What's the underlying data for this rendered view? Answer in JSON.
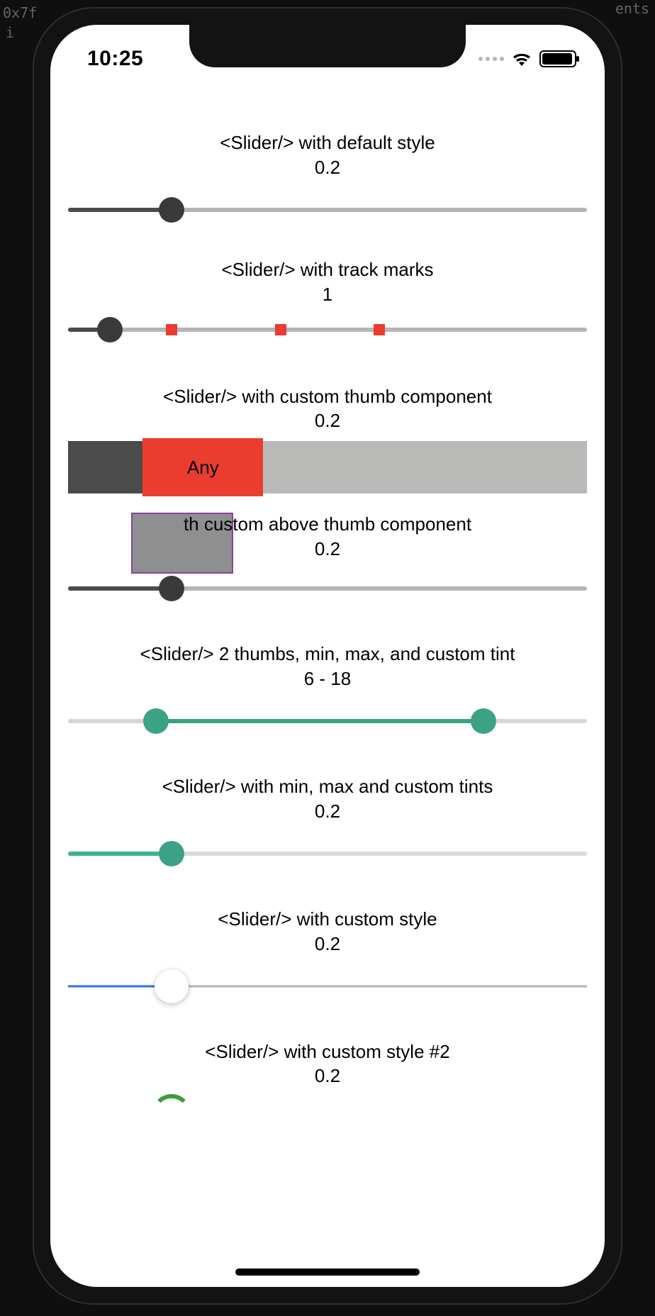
{
  "status_bar": {
    "time": "10:25"
  },
  "examples": [
    {
      "title": "<Slider/> with default style",
      "value": "0.2",
      "pct": 20,
      "type": "default"
    },
    {
      "title": "<Slider/> with track marks",
      "value": "1",
      "pct": 8,
      "type": "marks",
      "marks_pct": [
        20,
        41,
        60
      ]
    },
    {
      "title": "<Slider/> with custom thumb component",
      "value": "0.2",
      "pct": 20,
      "type": "big_thumb",
      "thumb_label": "Any"
    },
    {
      "title": "th custom above thumb component",
      "value": "0.2",
      "pct": 20,
      "type": "above_thumb"
    },
    {
      "title": "<Slider/> 2 thumbs, min, max, and custom tint",
      "value": "6 - 18",
      "low_pct": 17,
      "high_pct": 80,
      "type": "range_green"
    },
    {
      "title": "<Slider/> with min, max and custom tints",
      "value": "0.2",
      "pct": 20,
      "type": "green_tint"
    },
    {
      "title": "<Slider/> with custom style",
      "value": "0.2",
      "pct": 20,
      "type": "custom_blue"
    },
    {
      "title": "<Slider/> with custom style #2",
      "value": "0.2",
      "pct": 20,
      "type": "custom_arc"
    }
  ],
  "bg": {
    "hex": "0x7f",
    "i": "i",
    "ents": "ents"
  }
}
